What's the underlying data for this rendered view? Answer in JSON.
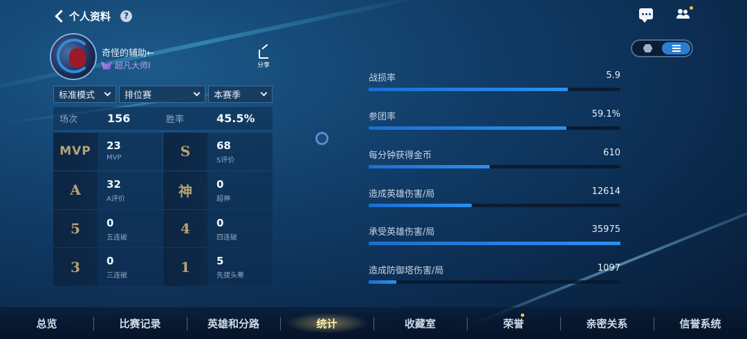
{
  "header": {
    "title": "个人资料",
    "help_glyph": "?"
  },
  "profile": {
    "username": "奇怪的辅助←",
    "rank": "超凡大师I",
    "share_label": "分享"
  },
  "filters": [
    {
      "label": "标准模式"
    },
    {
      "label": "排位赛"
    },
    {
      "label": "本赛季"
    }
  ],
  "summary": {
    "matches_label": "场次",
    "matches_value": "156",
    "winrate_label": "胜率",
    "winrate_value": "45.5%"
  },
  "achievements": [
    {
      "symbol": "MVP",
      "value": "23",
      "label": "MVP"
    },
    {
      "symbol": "S",
      "value": "68",
      "label": "S评价"
    },
    {
      "symbol": "A",
      "value": "32",
      "label": "A评价"
    },
    {
      "symbol": "神",
      "value": "0",
      "label": "超神"
    },
    {
      "symbol": "5",
      "value": "0",
      "label": "五连破"
    },
    {
      "symbol": "4",
      "value": "0",
      "label": "四连破"
    },
    {
      "symbol": "3",
      "value": "0",
      "label": "三连破"
    },
    {
      "symbol": "1",
      "value": "5",
      "label": "先拔头筹"
    }
  ],
  "stats": [
    {
      "name": "战损率",
      "value": "5.9",
      "fill": 0.79
    },
    {
      "name": "参团率",
      "value": "59.1%",
      "fill": 0.785
    },
    {
      "name": "每分钟获得金币",
      "value": "610",
      "fill": 0.48
    },
    {
      "name": "造成英雄伤害/局",
      "value": "12614",
      "fill": 0.41
    },
    {
      "name": "承受英雄伤害/局",
      "value": "35975",
      "fill": 1.0
    },
    {
      "name": "造成防御塔伤害/局",
      "value": "1097",
      "fill": 0.11
    }
  ],
  "nav": {
    "tabs": [
      {
        "label": "总览"
      },
      {
        "label": "比赛记录"
      },
      {
        "label": "英雄和分路"
      },
      {
        "label": "统计"
      },
      {
        "label": "收藏室"
      },
      {
        "label": "荣誉"
      },
      {
        "label": "亲密关系"
      },
      {
        "label": "信誉系统"
      }
    ],
    "active": "统计"
  },
  "colors": {
    "accent": "#2a7fd0",
    "badge": "#f6c34a",
    "rank": "#b9a2e8"
  }
}
